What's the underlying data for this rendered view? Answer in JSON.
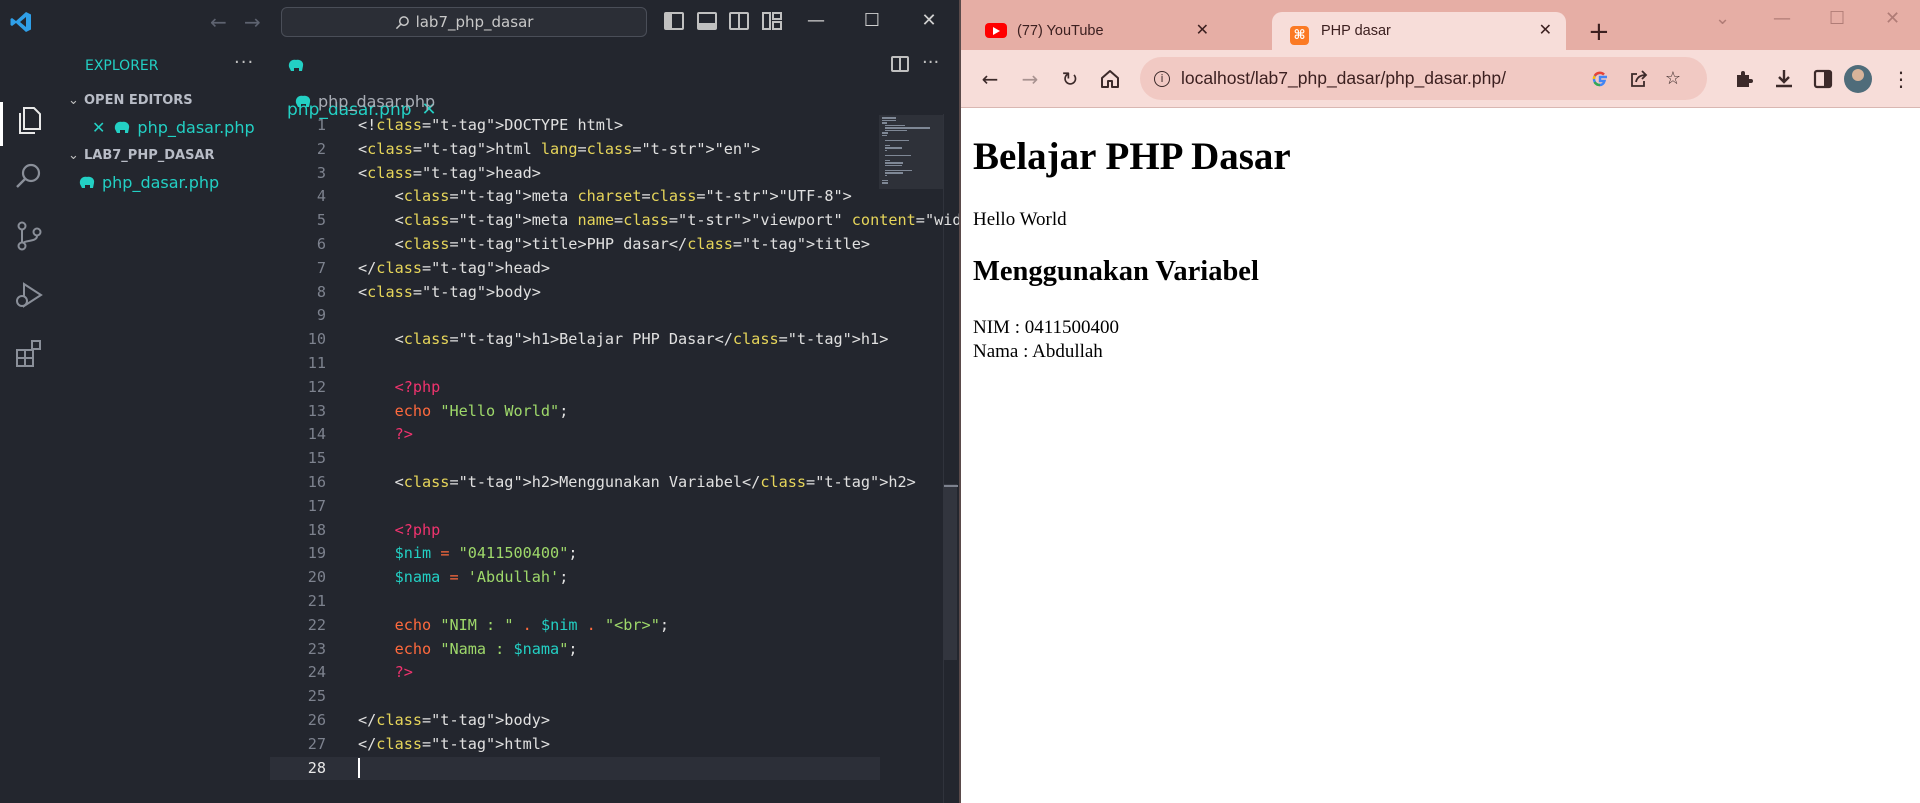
{
  "vscode": {
    "search_text": "lab7_php_dasar",
    "explorer_title": "EXPLORER",
    "open_editors_label": "OPEN EDITORS",
    "open_editor_file": "php_dasar.php",
    "project_label": "LAB7_PHP_DASAR",
    "project_file": "php_dasar.php",
    "tab_label": "php_dasar.php",
    "breadcrumb": "php_dasar.php",
    "line_numbers": [
      "1",
      "2",
      "3",
      "4",
      "5",
      "6",
      "7",
      "8",
      "9",
      "10",
      "11",
      "12",
      "13",
      "14",
      "15",
      "16",
      "17",
      "18",
      "19",
      "20",
      "21",
      "22",
      "23",
      "24",
      "25",
      "26",
      "27",
      "28"
    ],
    "code_lines": [
      "<!DOCTYPE html>",
      "<html lang=\"en\">",
      "<head>",
      "    <meta charset=\"UTF-8\">",
      "    <meta name=\"viewport\" content=\"width=device-width,",
      "    <title>PHP dasar</title>",
      "</head>",
      "<body>",
      "",
      "    <h1>Belajar PHP Dasar</h1>",
      "",
      "    <?php",
      "    echo \"Hello World\";",
      "    ?>",
      "",
      "    <h2>Menggunakan Variabel</h2>",
      "",
      "    <?php",
      "    $nim = \"0411500400\";",
      "    $nama = 'Abdullah';",
      "",
      "    echo \"NIM : \" . $nim . \"<br>\";",
      "    echo \"Nama : $nama\";",
      "    ?>",
      "",
      "</body>",
      "</html>",
      ""
    ],
    "current_line": 28,
    "colors": {
      "accent": "#23d0c4",
      "tag": "#f0336e",
      "attr": "#e6d55a",
      "string": "#9ed86a",
      "keyword": "#ff6a3d"
    }
  },
  "chrome": {
    "tab1_title": "(77) YouTube",
    "tab2_title": "PHP dasar",
    "url": "localhost/lab7_php_dasar/php_dasar.php/",
    "page": {
      "h1": "Belajar PHP Dasar",
      "hello": "Hello World",
      "h2": "Menggunakan Variabel",
      "nim": "NIM : 0411500400",
      "nama": "Nama : Abdullah"
    },
    "colors": {
      "tabstrip": "#e6aea5",
      "toolbar": "#f7ddd9",
      "omnibox": "#f1c9c3"
    }
  }
}
